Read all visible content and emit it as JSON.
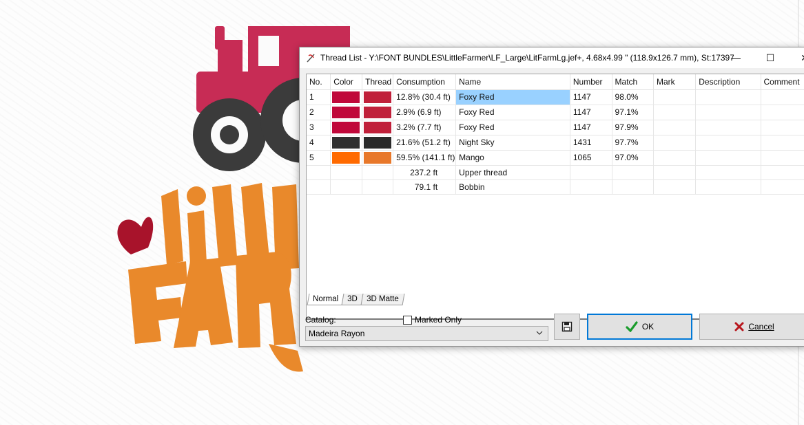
{
  "dialog": {
    "title": "Thread List - Y:\\FONT BUNDLES\\LittleFarmer\\LF_Large\\LitFarmLg.jef+, 4.68x4.99 \" (118.9x126.7 mm), St:17397...",
    "controls": {
      "minimize": "—",
      "maximize": "☐",
      "close": "✕"
    }
  },
  "table": {
    "columns": [
      "No.",
      "Color",
      "Thread",
      "Consumption",
      "Name",
      "Number",
      "Match",
      "Mark",
      "Description",
      "Comment"
    ],
    "rows": [
      {
        "no": "1",
        "color": "#c0083a",
        "thread": "#c0203a",
        "consumption": "12.8%  (30.4 ft)",
        "name": "Foxy Red",
        "number": "1147",
        "match": "98.0%",
        "selected": true
      },
      {
        "no": "2",
        "color": "#c0083a",
        "thread": "#c0203a",
        "consumption": "2.9%  (6.9 ft)",
        "name": "Foxy Red",
        "number": "1147",
        "match": "97.1%"
      },
      {
        "no": "3",
        "color": "#c0083a",
        "thread": "#c0203a",
        "consumption": "3.2%  (7.7 ft)",
        "name": "Foxy Red",
        "number": "1147",
        "match": "97.9%"
      },
      {
        "no": "4",
        "color": "#303030",
        "thread": "#2a2a2a",
        "consumption": "21.6%  (51.2 ft)",
        "name": "Night Sky",
        "number": "1431",
        "match": "97.7%"
      },
      {
        "no": "5",
        "color": "#ff6a00",
        "thread": "#e8782a",
        "consumption": "59.5%  (141.1 ft)",
        "name": "Mango",
        "number": "1065",
        "match": "97.0%"
      }
    ],
    "totals": [
      {
        "consumption": "237.2 ft",
        "name": "Upper thread"
      },
      {
        "consumption": "79.1 ft",
        "name": "Bobbin"
      }
    ]
  },
  "tabs": [
    "Normal",
    "3D",
    "3D Matte"
  ],
  "active_tab": "Normal",
  "catalog": {
    "label": "Catalog:",
    "value": "Madeira Rayon"
  },
  "marked_only": {
    "label": "Marked Only",
    "checked": false
  },
  "buttons": {
    "ok": "OK",
    "cancel": "Cancel"
  },
  "icons": {
    "app": "needle-icon",
    "save": "floppy-disk-icon",
    "ok": "green-checkmark-icon",
    "cancel": "red-x-icon",
    "catalog_dropdown": "chevron-down-icon"
  },
  "colors": {
    "selection": "#99d1ff",
    "ok_border": "#0078d7"
  }
}
